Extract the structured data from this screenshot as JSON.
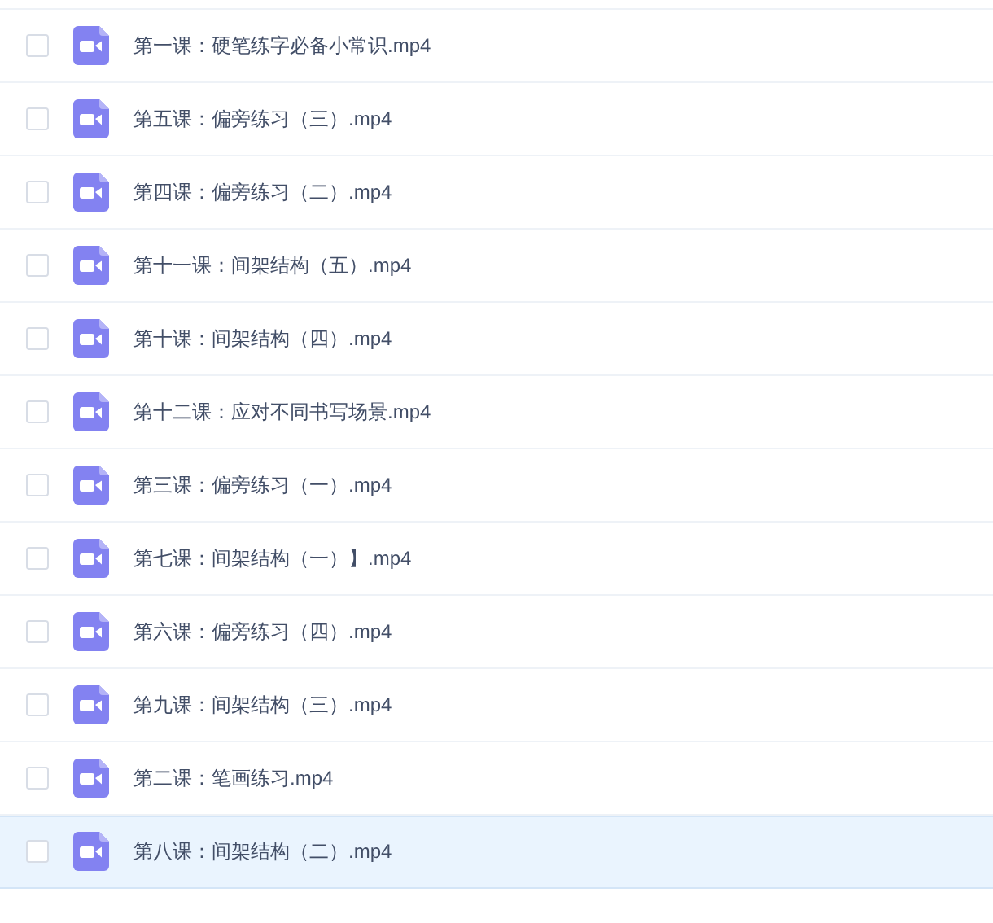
{
  "files": [
    {
      "name": "第一课：硬笔练字必备小常识.mp4",
      "checked": false,
      "hovered": false
    },
    {
      "name": "第五课：偏旁练习（三）.mp4",
      "checked": false,
      "hovered": false
    },
    {
      "name": "第四课：偏旁练习（二）.mp4",
      "checked": false,
      "hovered": false
    },
    {
      "name": "第十一课：间架结构（五）.mp4",
      "checked": false,
      "hovered": false
    },
    {
      "name": "第十课：间架结构（四）.mp4",
      "checked": false,
      "hovered": false
    },
    {
      "name": "第十二课：应对不同书写场景.mp4",
      "checked": false,
      "hovered": false
    },
    {
      "name": "第三课：偏旁练习（一）.mp4",
      "checked": false,
      "hovered": false
    },
    {
      "name": "第七课：间架结构（一）】.mp4",
      "checked": false,
      "hovered": false
    },
    {
      "name": "第六课：偏旁练习（四）.mp4",
      "checked": false,
      "hovered": false
    },
    {
      "name": "第九课：间架结构（三）.mp4",
      "checked": false,
      "hovered": false
    },
    {
      "name": "第二课：笔画练习.mp4",
      "checked": false,
      "hovered": false
    },
    {
      "name": "第八课：间架结构（二）.mp4",
      "checked": false,
      "hovered": true
    }
  ]
}
